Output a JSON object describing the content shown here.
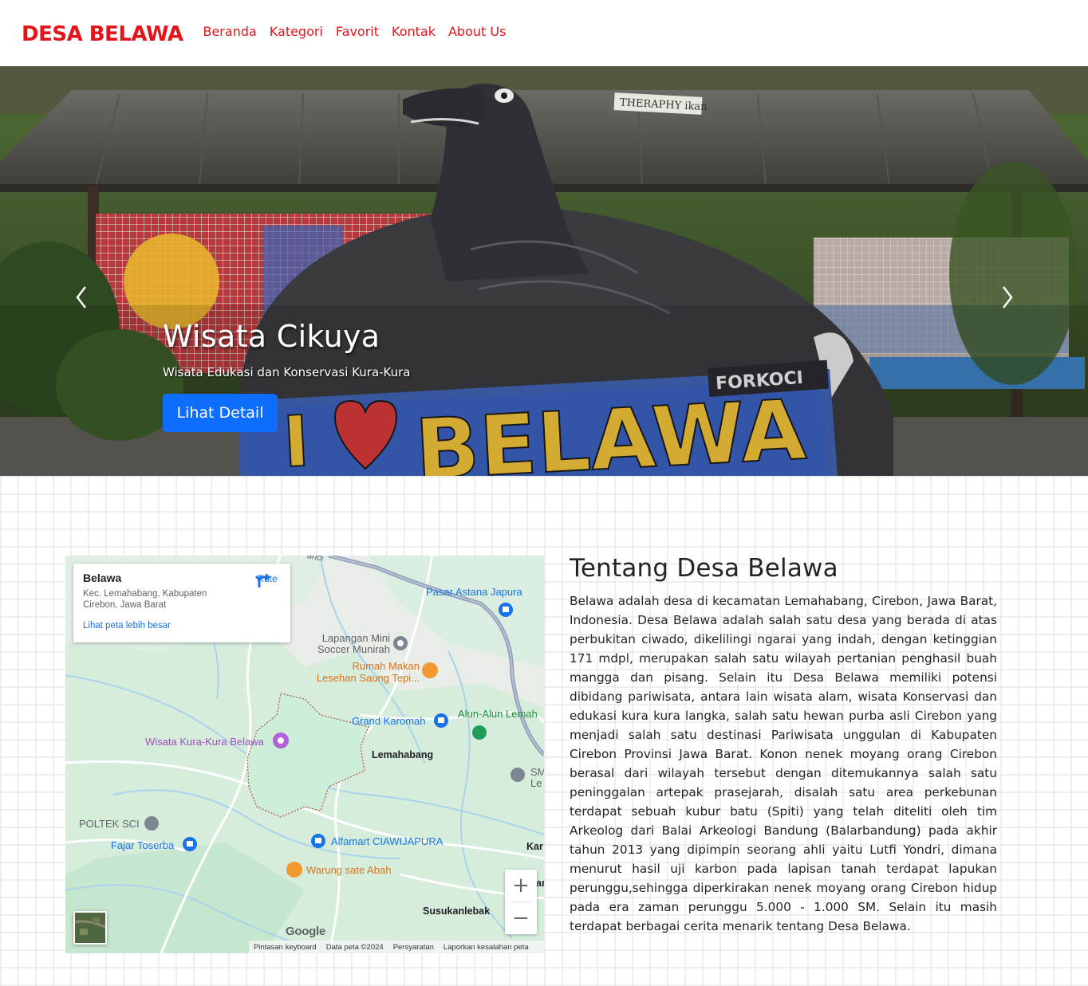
{
  "navbar": {
    "brand": "DESA BELAWA",
    "links": [
      "Beranda",
      "Kategori",
      "Favorit",
      "Kontak",
      "About Us"
    ]
  },
  "hero": {
    "title": "Wisata Cikuya",
    "subtitle": "Wisata Edukasi dan Konservasi Kura-Kura",
    "button_label": "Lihat Detail",
    "prev_icon": "chevron-left-icon",
    "next_icon": "chevron-right-icon",
    "scene_sign_top": "THERAPHY ikan",
    "scene_sign_forkoci": "FORKOCI",
    "scene_sign_main": "BELAWA",
    "scene_sign_i": "I"
  },
  "map": {
    "card_title": "Belawa",
    "card_address": "Kec. Lemahabang, Kabupaten Cirebon, Jawa Barat",
    "card_link": "Lihat peta lebih besar",
    "route_label": "Rute",
    "labels": {
      "pasar": "Pasar Astana Japura",
      "lapangan": "Lapangan Mini Soccer Munirah",
      "rumah_makan": "Rumah Makan Lesehan Saung Tepi...",
      "grand": "Grand Karomah",
      "alun": "Alun-Alun Lemah",
      "wisata": "Wisata Kura-Kura Belawa",
      "lemahabang": "Lemahabang",
      "poltek": "POLTEK SCI",
      "fajar": "Fajar Toserba",
      "alfamart": "Alfamart CIAWIJAPURA",
      "warung": "Warung sate Abah",
      "susukan": "Susukanlebak",
      "edge_kar": "Kar",
      "edge_sm": "SM",
      "edge_le": "Le",
      "edge_ar": "ar",
      "edge_anci": "anci"
    },
    "google": "Google",
    "footer": [
      "Pintasan keyboard",
      "Data peta ©2024",
      "Persyaratan",
      "Laporkan kesalahan peta"
    ],
    "zoom_in": "+",
    "zoom_out": "−"
  },
  "about": {
    "title": "Tentang Desa Belawa",
    "body": "Belawa adalah desa di kecamatan Lemahabang, Cirebon, Jawa Barat, Indonesia. Desa Belawa adalah salah satu desa yang berada di atas perbukitan ciwado, dikelilingi ngarai yang indah, dengan ketinggian 171 mdpl, merupakan salah satu wilayah pertanian penghasil buah mangga dan pisang. Selain itu Desa Belawa memiliki potensi dibidang pariwisata, antara lain wisata alam, wisata Konservasi dan edukasi kura kura langka, salah satu hewan purba asli Cirebon yang menjadi salah satu destinasi Pariwisata unggulan di Kabupaten Cirebon Provinsi Jawa Barat. Konon nenek moyang orang Cirebon berasal dari wilayah tersebut dengan ditemukannya salah satu peninggalan artepak prasejarah, disalah satu area perkebunan terdapat sebuah kubur batu (Spiti) yang telah diteliti oleh tim Arkeolog dari Balai Arkeologi Bandung (Balarbandung) pada akhir tahun 2013 yang dipimpin seorang ahli yaitu Lutfi Yondri, dimana menurut hasil uji karbon pada lapisan tanah terdapat lapukan perunggu,sehingga diperkirakan nenek moyang orang Cirebon hidup pada era zaman perunggu 5.000 - 1.000 SM. Selain itu masih terdapat berbagai cerita menarik tentang Desa Belawa."
  },
  "colors": {
    "brand": "#e3151b",
    "primary_button": "#0d6efd",
    "map_link": "#1a73e8"
  }
}
